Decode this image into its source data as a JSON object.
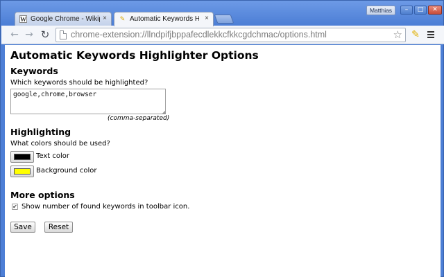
{
  "window": {
    "user_name": "Matthias",
    "min_symbol": "–",
    "max_symbol": "□",
    "close_symbol": "✕"
  },
  "tabs": [
    {
      "title": "Google Chrome - Wikiped",
      "favicon": "W",
      "close": "×",
      "active": false
    },
    {
      "title": "Automatic Keywords Highl",
      "favicon": "✎",
      "close": "×",
      "active": true
    }
  ],
  "toolbar": {
    "back_icon": "←",
    "forward_icon": "→",
    "reload_icon": "↻",
    "url": "chrome-extension://llndpifjbppafecdlekkcfkkcgdchmac/options.html",
    "star_icon": "☆",
    "extension_icon": "✎"
  },
  "page": {
    "title": "Automatic Keywords Highlighter Options",
    "keywords": {
      "heading": "Keywords",
      "question": "Which keywords should be highlighted?",
      "value": "google,chrome,browser",
      "hint": "(comma-separated)"
    },
    "highlighting": {
      "heading": "Highlighting",
      "question": "What colors should be used?",
      "text_color_label": "Text color",
      "text_color": "#000000",
      "background_color_label": "Background color",
      "background_color": "#ffff00"
    },
    "more_options": {
      "heading": "More options",
      "show_count_label": "Show number of found keywords in toolbar icon.",
      "show_count_checked": true,
      "check_mark": "✔"
    },
    "buttons": {
      "save": "Save",
      "reset": "Reset"
    }
  }
}
